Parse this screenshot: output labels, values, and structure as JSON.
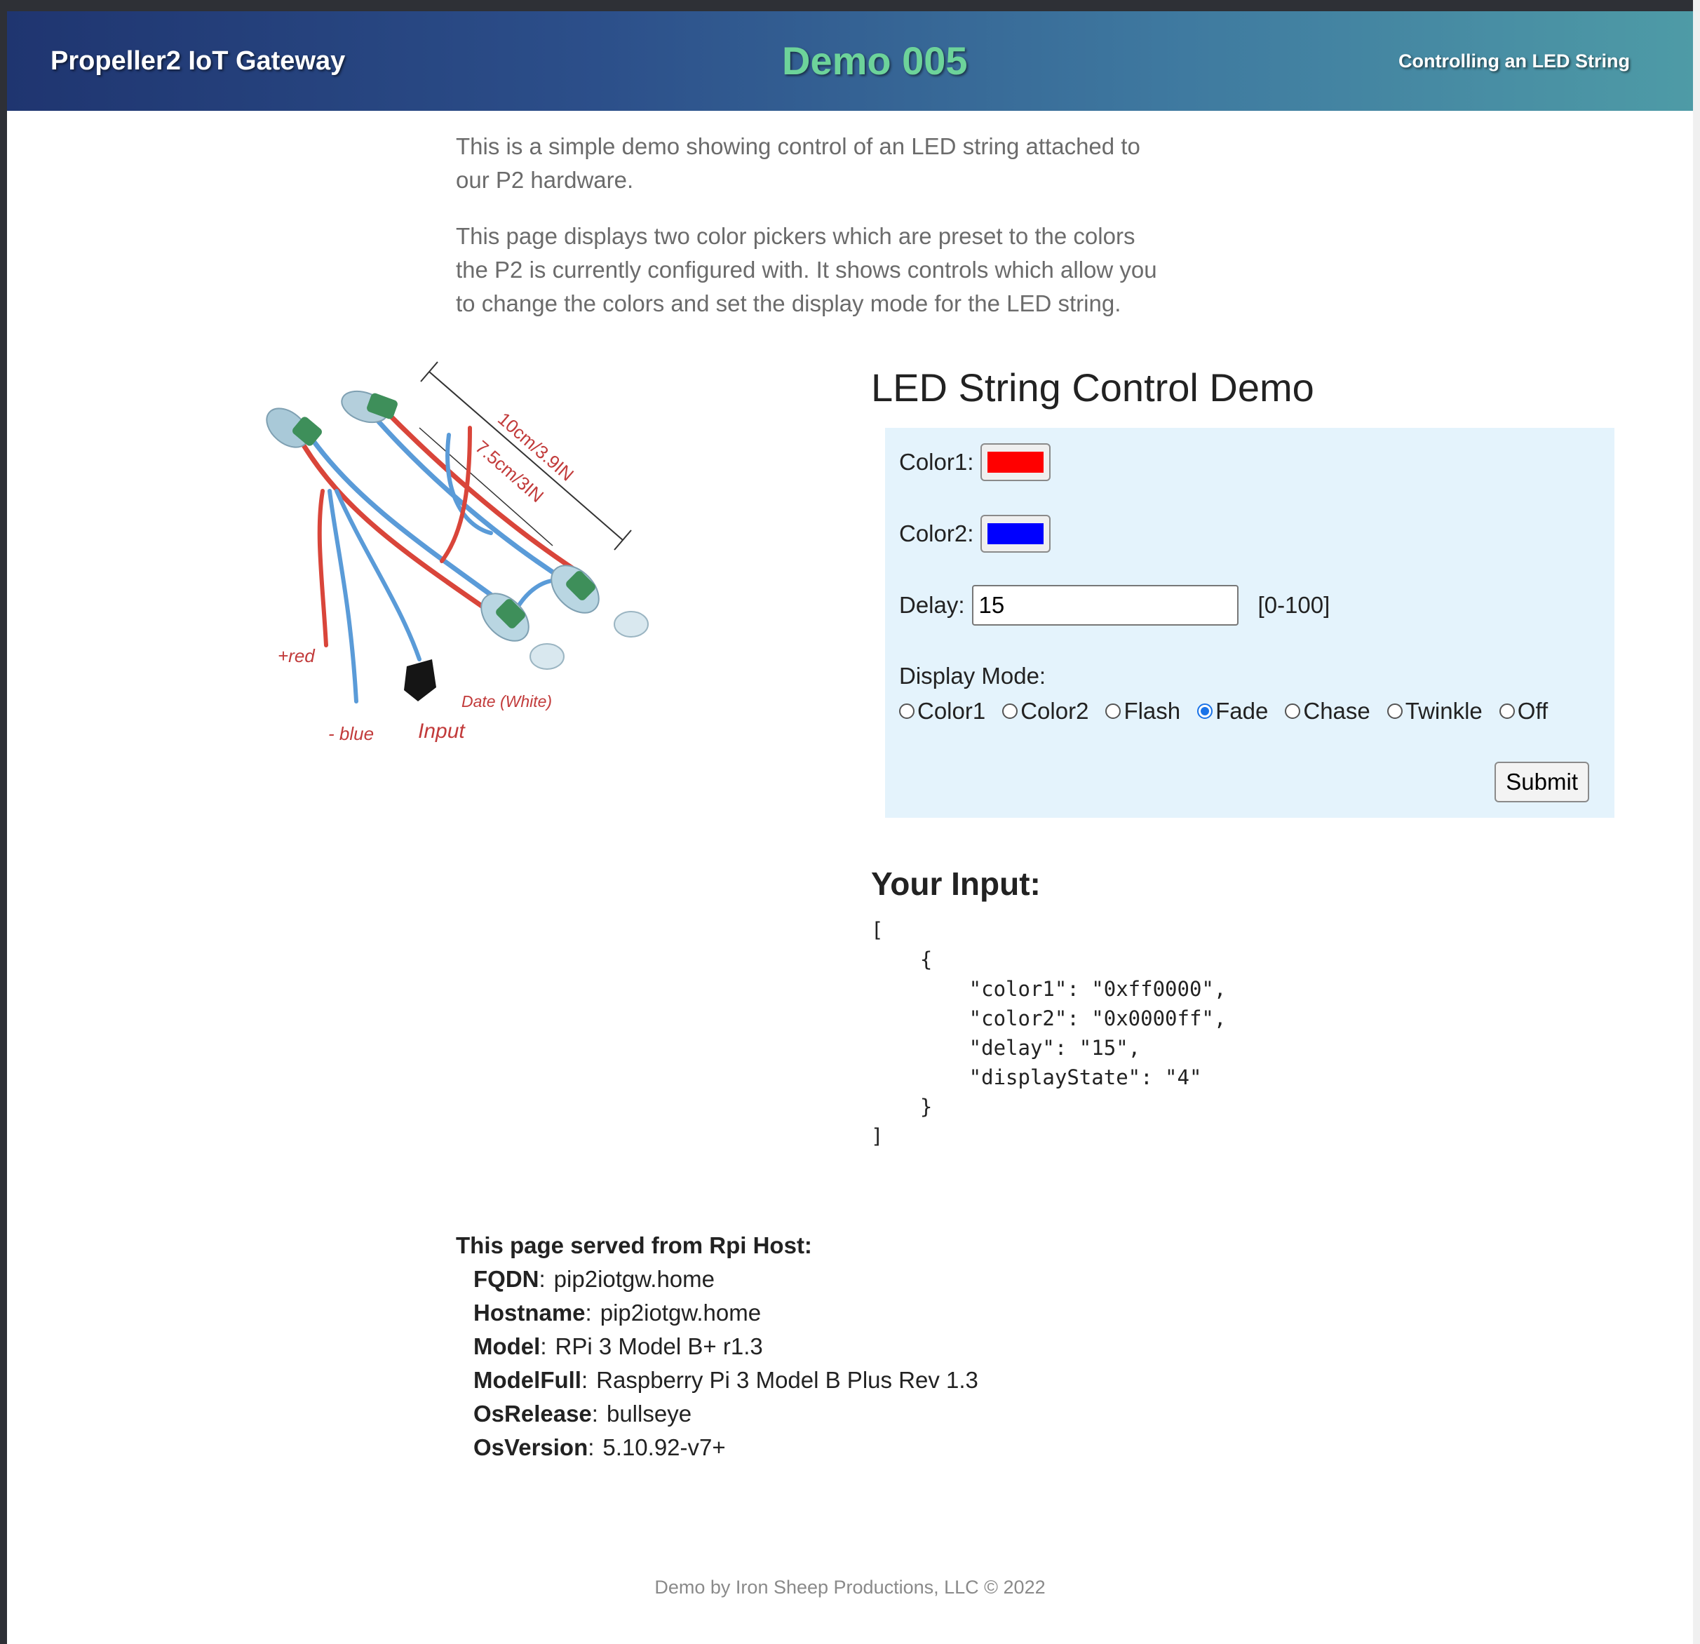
{
  "header": {
    "brand": "Propeller2 IoT Gateway",
    "demo_title": "Demo 005",
    "subtitle": "Controlling an LED String"
  },
  "intro": {
    "p1": "This is a simple demo showing control of an LED string attached to our P2 hardware.",
    "p2": "This page displays two color pickers which are preset to the colors the P2 is currently configured with. It shows controls which allow you to change the colors and set the display mode for the LED string."
  },
  "photo": {
    "label_length1": "10cm/3.9IN",
    "label_length2": "7.5cm/3IN",
    "label_red": "+red",
    "label_blue": "- blue",
    "label_input": "Input",
    "label_data": "Date (White)"
  },
  "panel": {
    "title": "LED String Control Demo",
    "color1_label": "Color1:",
    "color1_value": "#ff0000",
    "color2_label": "Color2:",
    "color2_value": "#0000ff",
    "delay_label": "Delay:",
    "delay_value": "15",
    "delay_range": "[0-100]",
    "mode_label": "Display Mode:",
    "modes": [
      {
        "label": "Color1",
        "checked": false
      },
      {
        "label": "Color2",
        "checked": false
      },
      {
        "label": "Flash",
        "checked": false
      },
      {
        "label": "Fade",
        "checked": true
      },
      {
        "label": "Chase",
        "checked": false
      },
      {
        "label": "Twinkle",
        "checked": false
      },
      {
        "label": "Off",
        "checked": false
      }
    ],
    "submit_label": "Submit"
  },
  "output": {
    "title": "Your Input:",
    "json_text": "[\n    {\n        \"color1\": \"0xff0000\",\n        \"color2\": \"0x0000ff\",\n        \"delay\": \"15\",\n        \"displayState\": \"4\"\n    }\n]"
  },
  "host": {
    "heading": "This page served from Rpi Host:",
    "items": [
      {
        "key": "FQDN",
        "value": "pip2iotgw.home"
      },
      {
        "key": "Hostname",
        "value": "pip2iotgw.home"
      },
      {
        "key": "Model",
        "value": "RPi 3 Model B+ r1.3"
      },
      {
        "key": "ModelFull",
        "value": "Raspberry Pi 3 Model B Plus Rev 1.3"
      },
      {
        "key": "OsRelease",
        "value": "bullseye"
      },
      {
        "key": "OsVersion",
        "value": "5.10.92-v7+"
      }
    ]
  },
  "footer": {
    "text": "Demo  by Iron Sheep Productions, LLC © 2022"
  },
  "colors": {
    "header_gradient_start": "#1f3570",
    "header_gradient_end": "#4e9ba6",
    "demo_title": "#6dd39a",
    "panel_bg": "#e4f3fc",
    "radio_checked": "#1a73e8"
  }
}
